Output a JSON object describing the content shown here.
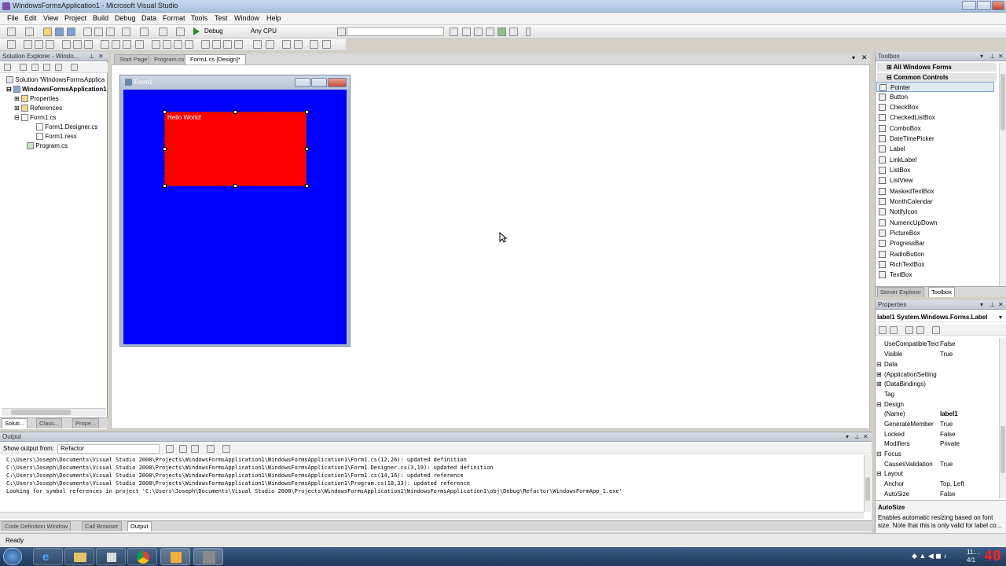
{
  "window": {
    "title": "WindowsFormsApplication1 - Microsoft Visual Studio"
  },
  "menu": [
    "File",
    "Edit",
    "View",
    "Project",
    "Build",
    "Debug",
    "Data",
    "Format",
    "Tools",
    "Test",
    "Window",
    "Help"
  ],
  "toolbar": {
    "config": "Debug",
    "platform": "Any CPU"
  },
  "solution_explorer": {
    "header": "Solution Explorer - Windo...",
    "items": [
      {
        "label": "Solution 'WindowsFormsApplica"
      },
      {
        "label": "WindowsFormsApplication1"
      },
      {
        "label": "Properties"
      },
      {
        "label": "References"
      },
      {
        "label": "Form1.cs"
      },
      {
        "label": "Form1.Designer.cs"
      },
      {
        "label": "Form1.resx"
      },
      {
        "label": "Program.cs"
      }
    ],
    "bottom_tabs": [
      "Soluti...",
      "Class...",
      "Prope..."
    ]
  },
  "editor_tabs": [
    "Start Page",
    "Program.cs",
    "Form1.cs [Design]*"
  ],
  "form": {
    "title": "Form1",
    "label_text": "Hello World!",
    "bg_color": "#0000ff",
    "label_color": "#ff0000"
  },
  "toolbox": {
    "header": "Toolbox",
    "group_all": "All Windows Forms",
    "group_common": "Common Controls",
    "items": [
      "Pointer",
      "Button",
      "CheckBox",
      "CheckedListBox",
      "ComboBox",
      "DateTimePicker",
      "Label",
      "LinkLabel",
      "ListBox",
      "ListView",
      "MaskedTextBox",
      "MonthCalendar",
      "NotifyIcon",
      "NumericUpDown",
      "PictureBox",
      "ProgressBar",
      "RadioButton",
      "RichTextBox",
      "TextBox"
    ],
    "bottom_tabs": [
      "Server Explorer",
      "Toolbox"
    ]
  },
  "properties": {
    "header": "Properties",
    "object": "label1 System.Windows.Forms.Label",
    "rows": [
      {
        "name": "UseCompatibleText",
        "value": "False"
      },
      {
        "name": "Visible",
        "value": "True"
      },
      {
        "name": "Data",
        "value": ""
      },
      {
        "name": "(ApplicationSetting",
        "value": ""
      },
      {
        "name": "(DataBindings)",
        "value": ""
      },
      {
        "name": "Tag",
        "value": ""
      },
      {
        "name": "Design",
        "value": ""
      },
      {
        "name": "(Name)",
        "value": "label1"
      },
      {
        "name": "GenerateMember",
        "value": "True"
      },
      {
        "name": "Locked",
        "value": "False"
      },
      {
        "name": "Modifiers",
        "value": "Private"
      },
      {
        "name": "Focus",
        "value": ""
      },
      {
        "name": "CausesValidation",
        "value": "True"
      },
      {
        "name": "Layout",
        "value": ""
      },
      {
        "name": "Anchor",
        "value": "Top, Left"
      },
      {
        "name": "AutoSize",
        "value": "False"
      }
    ],
    "desc_title": "AutoSize",
    "desc_text1": "Enables automatic resizing based on font",
    "desc_text2": "size. Note that this is only valid for label co..."
  },
  "output": {
    "header": "Output",
    "show_from_label": "Show output from:",
    "show_from_value": "Refactor",
    "lines": [
      "C:\\Users\\Joseph\\Documents\\Visual Studio 2008\\Projects\\WindowsFormsApplication1\\WindowsFormsApplication1\\Form1.cs(12,26): updated definition",
      "C:\\Users\\Joseph\\Documents\\Visual Studio 2008\\Projects\\WindowsFormsApplication1\\WindowsFormsApplication1\\Form1.Designer.cs(3,19): updated definition",
      "C:\\Users\\Joseph\\Documents\\Visual Studio 2008\\Projects\\WindowsFormsApplication1\\WindowsFormsApplication1\\Form1.cs(14,16): updated reference",
      "C:\\Users\\Joseph\\Documents\\Visual Studio 2008\\Projects\\WindowsFormsApplication1\\WindowsFormsApplication1\\Program.cs(18,33): updated reference",
      "Looking for symbol references in project 'C:\\Users\\Joseph\\Documents\\Visual Studio 2008\\Projects\\WindowsFormsApplication1\\WindowsFormsApplication1\\obj\\Debug\\Refactor\\WindowsFormApp_1.exe'"
    ],
    "bottom_tabs": [
      "Code Definition Window",
      "Call Browser",
      "Output"
    ]
  },
  "status": {
    "text": "Ready"
  },
  "taskbar": {
    "time": "11:...",
    "date": "4/1",
    "badge": "40"
  }
}
